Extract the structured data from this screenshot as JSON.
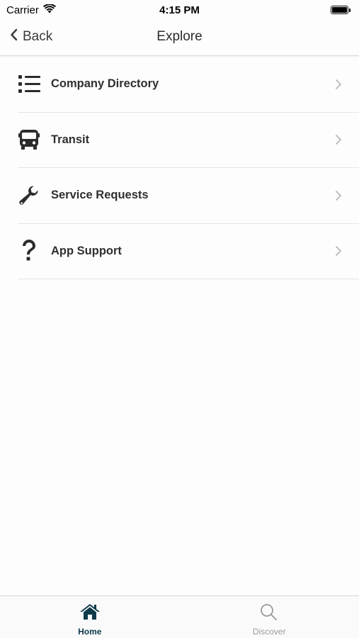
{
  "status_bar": {
    "carrier": "Carrier",
    "time": "4:15 PM"
  },
  "nav": {
    "back_label": "Back",
    "title": "Explore"
  },
  "menu": {
    "items": [
      {
        "label": "Company Directory",
        "icon": "list-icon"
      },
      {
        "label": "Transit",
        "icon": "bus-icon"
      },
      {
        "label": "Service Requests",
        "icon": "wrench-icon"
      },
      {
        "label": "App Support",
        "icon": "question-mark-icon"
      }
    ]
  },
  "tab_bar": {
    "home_label": "Home",
    "discover_label": "Discover",
    "active_tab": "Home"
  },
  "colors": {
    "accent": "#0e3a4a",
    "inactive": "#9a9a9a",
    "chevron": "#b8b8bc"
  }
}
